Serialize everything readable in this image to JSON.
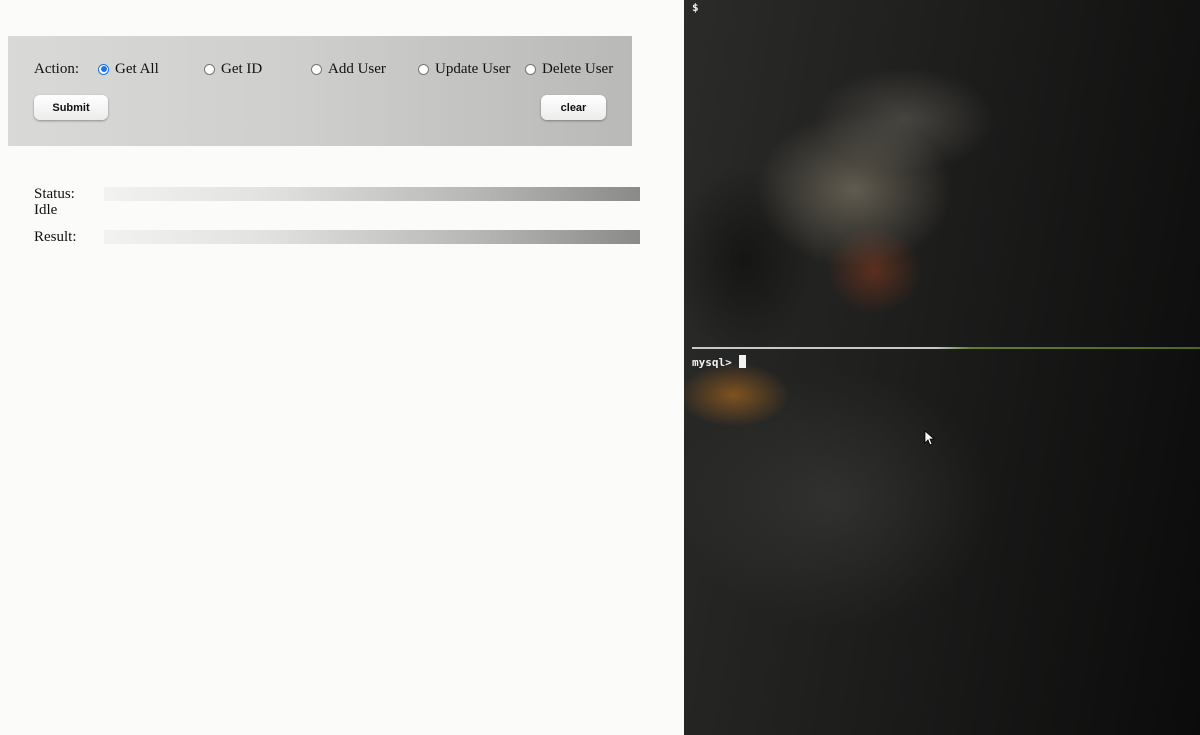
{
  "form": {
    "action_label": "Action:",
    "options": [
      {
        "label": "Get All",
        "checked": true
      },
      {
        "label": "Get ID",
        "checked": false
      },
      {
        "label": "Add User",
        "checked": false
      },
      {
        "label": "Update User",
        "checked": false
      },
      {
        "label": "Delete User",
        "checked": false
      }
    ],
    "submit_label": "Submit",
    "clear_label": "clear"
  },
  "status": {
    "label": "Status:",
    "value": "Idle"
  },
  "result": {
    "label": "Result:"
  },
  "terminal": {
    "top_prompt": "$",
    "bottom_prompt": "mysql>"
  },
  "colors": {
    "radio_accent": "#1a73e8",
    "panel_bg": "#cfcfcd",
    "divider_green": "#5f7f2a"
  },
  "icons": {
    "pointer": "mouse-pointer-icon"
  }
}
